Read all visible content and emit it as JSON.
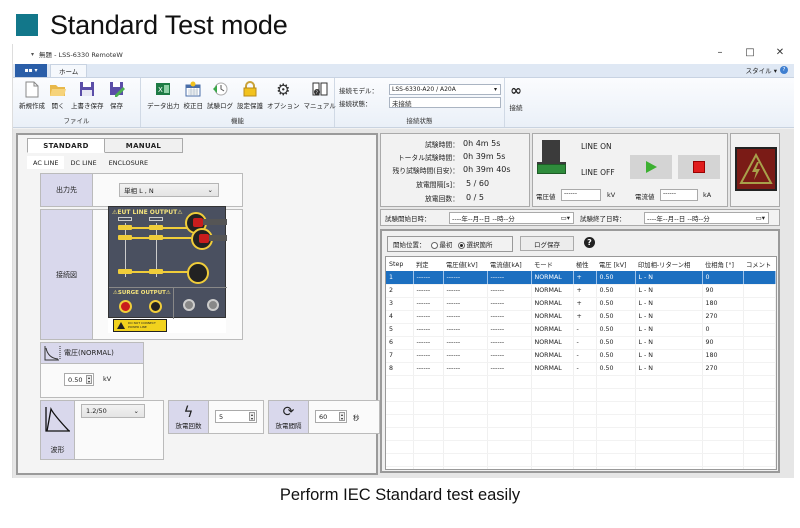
{
  "header": {
    "title": "Standard Test mode",
    "accent": "#12778a"
  },
  "window": {
    "title": "無題 - LSS-6330 RemoteW",
    "controls": {
      "minimize": "–",
      "maximize": "□",
      "close": "✕"
    }
  },
  "ribbon": {
    "app_menu_label": "▪▪ ▾",
    "tabs": [
      "ホーム"
    ],
    "style_menu": "スタイル ▾",
    "groups": {
      "file": {
        "label": "ファイル",
        "buttons": [
          {
            "label": "新規作成",
            "icon": "new-file-icon"
          },
          {
            "label": "開く",
            "icon": "open-folder-icon"
          },
          {
            "label": "上書き保存",
            "icon": "save-icon"
          },
          {
            "label": "保存",
            "icon": "save-as-icon"
          }
        ]
      },
      "functions": {
        "label": "機能",
        "buttons": [
          {
            "label": "データ出力",
            "icon": "excel-icon"
          },
          {
            "label": "校正日",
            "icon": "calendar-icon"
          },
          {
            "label": "試験ログ",
            "icon": "history-icon"
          },
          {
            "label": "設定保護",
            "icon": "lock-icon"
          },
          {
            "label": "オプション",
            "icon": "gear-icon"
          },
          {
            "label": "マニュアル",
            "icon": "manual-icon"
          }
        ]
      },
      "connection": {
        "label": "接続状態",
        "model_label": "接続モデル：",
        "model_value": "LSS-6330-A20 / A20A",
        "status_label": "接続状態：",
        "status_value": "未接続",
        "connect_label": "接続"
      }
    }
  },
  "left": {
    "mode_tabs": [
      "STANDARD",
      "MANUAL"
    ],
    "sub_tabs": [
      "AC LINE",
      "DC LINE",
      "ENCLOSURE"
    ],
    "output_label": "出力先",
    "output_value": "単相 L , N",
    "diagram_label": "接続図",
    "diagram": {
      "eut_title": "⚠EUT LINE OUTPUT⚠",
      "surge_title": "⚠SURGE OUTPUT⚠",
      "terminals": [
        "L",
        "N",
        "PE",
        "+",
        "−",
        "PE"
      ],
      "warning_text": "DO NOT CONNECT POWER LINE"
    },
    "voltage": {
      "label": "電圧(NORMAL)",
      "value": "0.50",
      "unit": "kV"
    },
    "waveform": {
      "label": "波形",
      "value": "1.2/50"
    },
    "discharge_count": {
      "label": "放電回数",
      "value": "5"
    },
    "discharge_interval": {
      "label": "放電間隔",
      "value": "60",
      "unit": "秒"
    }
  },
  "status": {
    "rows": [
      {
        "label": "試験時間：",
        "value": "0h  4m  5s"
      },
      {
        "label": "トータル試験時間：",
        "value": "0h 39m  5s"
      },
      {
        "label": "残り試験時間(目安)：",
        "value": "0h 39m 40s"
      },
      {
        "label": "放電間隔[s]：",
        "value": "5 /  60"
      },
      {
        "label": "放電回数：",
        "value": "0 /   5"
      }
    ],
    "line_on": "LINE ON",
    "line_off": "LINE OFF",
    "voltage_label": "電圧値",
    "voltage_value": "------",
    "voltage_unit": "kV",
    "current_label": "電流値",
    "current_value": "------",
    "current_unit": "kA",
    "start_label": "試験開始日時：",
    "start_value": "----年--月--日 --時--分",
    "end_label": "試験終了日時：",
    "end_value": "----年--月--日 --時--分"
  },
  "log": {
    "start_pos_label": "開始位置：",
    "options": [
      "最初",
      "選択箇所"
    ],
    "selected_option": "選択箇所",
    "save_label": "ログ保存",
    "help": "?",
    "columns": [
      "Step",
      "判定",
      "電圧値[kV]",
      "電流値[kA]",
      "モード",
      "極性",
      "電圧 [kV]",
      "印加相-リターン相",
      "位相角 [°]",
      "コメント"
    ],
    "rows": [
      [
        "1",
        "------",
        "------",
        "------",
        "NORMAL",
        "+",
        "0.50",
        "L  - N",
        "0",
        ""
      ],
      [
        "2",
        "------",
        "------",
        "------",
        "NORMAL",
        "+",
        "0.50",
        "L  - N",
        "90",
        ""
      ],
      [
        "3",
        "------",
        "------",
        "------",
        "NORMAL",
        "+",
        "0.50",
        "L  - N",
        "180",
        ""
      ],
      [
        "4",
        "------",
        "------",
        "------",
        "NORMAL",
        "+",
        "0.50",
        "L  - N",
        "270",
        ""
      ],
      [
        "5",
        "------",
        "------",
        "------",
        "NORMAL",
        "-",
        "0.50",
        "L  - N",
        "0",
        ""
      ],
      [
        "6",
        "------",
        "------",
        "------",
        "NORMAL",
        "-",
        "0.50",
        "L  - N",
        "90",
        ""
      ],
      [
        "7",
        "------",
        "------",
        "------",
        "NORMAL",
        "-",
        "0.50",
        "L  - N",
        "180",
        ""
      ],
      [
        "8",
        "------",
        "------",
        "------",
        "NORMAL",
        "-",
        "0.50",
        "L  - N",
        "270",
        ""
      ]
    ],
    "selected_row": 0,
    "selection_color": "#1c6fc0"
  },
  "caption": "Perform IEC Standard test easily"
}
